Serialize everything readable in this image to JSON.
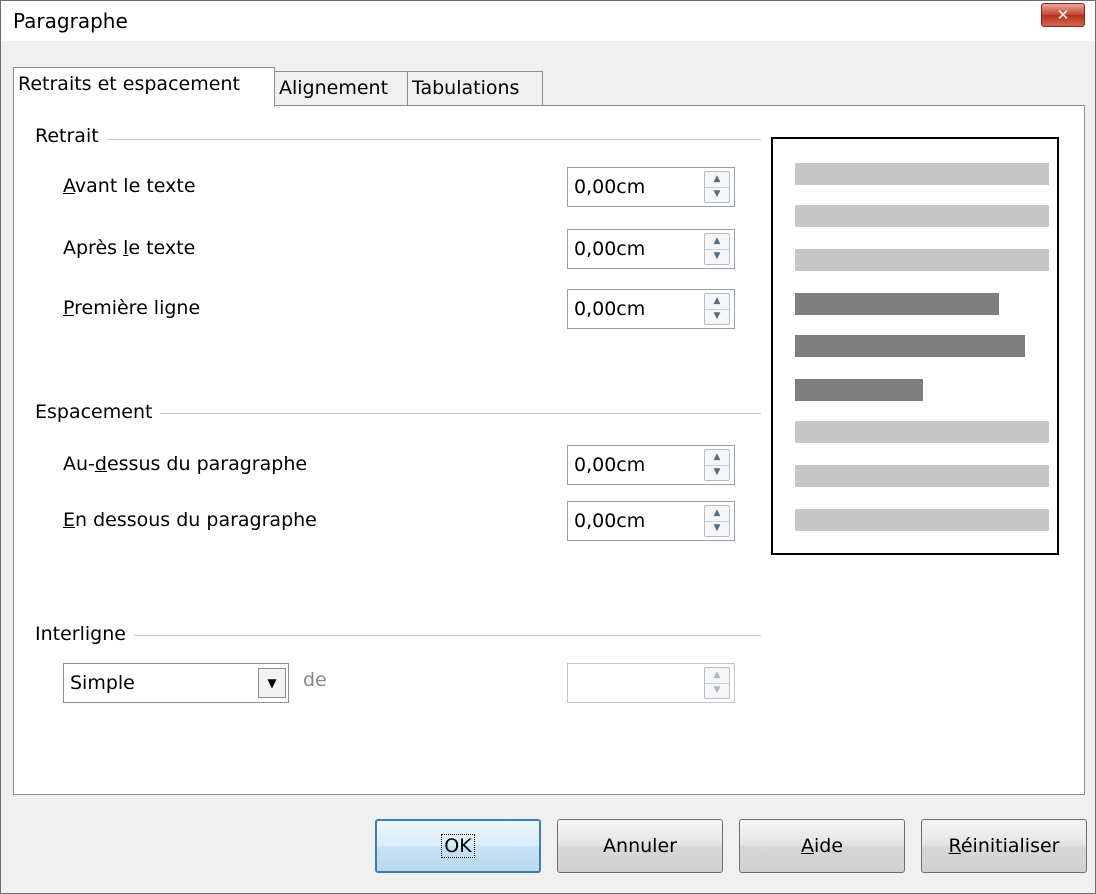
{
  "window": {
    "title": "Paragraphe",
    "close_icon": "close-icon"
  },
  "tabs": [
    {
      "label": "Retraits et espacement",
      "active": true
    },
    {
      "label": "Alignement",
      "active": false
    },
    {
      "label": "Tabulations",
      "active": false
    }
  ],
  "retrait": {
    "title": "Retrait",
    "avant": {
      "pre": "",
      "key": "A",
      "post": "vant le texte",
      "value": "0,00cm"
    },
    "apres": {
      "pre": "Après ",
      "key": "l",
      "post": "e texte",
      "value": "0,00cm"
    },
    "premiere": {
      "pre": "",
      "key": "P",
      "post": "remière ligne",
      "value": "0,00cm"
    }
  },
  "espacement": {
    "title": "Espacement",
    "dessus": {
      "pre": "Au-",
      "key": "d",
      "post": "essus du paragraphe",
      "value": "0,00cm"
    },
    "dessous": {
      "pre": "",
      "key": "E",
      "post": "n dessous du paragraphe",
      "value": "0,00cm"
    }
  },
  "interligne": {
    "title": "Interligne",
    "selected": "Simple",
    "de_label": "de",
    "value": ""
  },
  "buttons": {
    "ok": "OK",
    "annuler": "Annuler",
    "aide_key": "A",
    "aide_rest": "ide",
    "reinit_key": "R",
    "reinit_rest": "éinitialiser"
  },
  "colors": {
    "preview_light": "#c6c6c6",
    "preview_dark": "#7e7e7e",
    "default_button_border": "#3c7fb1"
  }
}
